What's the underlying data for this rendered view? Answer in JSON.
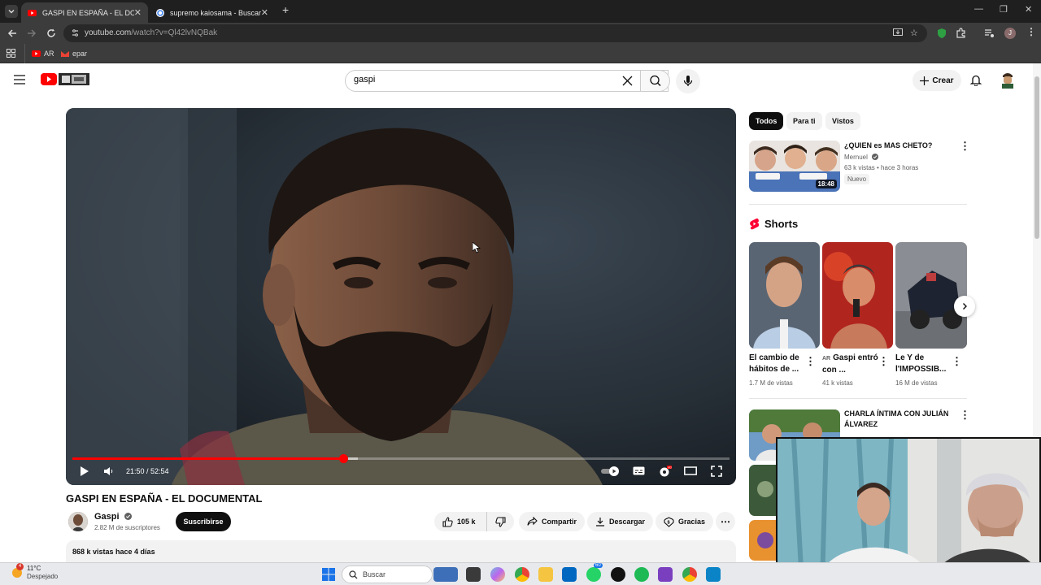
{
  "browser": {
    "tabs": [
      {
        "title": "GASPI EN ESPAÑA - EL DOCUM",
        "active": true
      },
      {
        "title": "supremo kaiosama - Buscar co",
        "active": false
      }
    ],
    "url": {
      "host": "youtube.com",
      "path": "/watch?v=Ql42lvNQBak"
    },
    "bookmarks": [
      "AR",
      "epar"
    ]
  },
  "youtube": {
    "search": {
      "query": "gaspi"
    },
    "create_label": "Crear"
  },
  "player": {
    "time": "21:50 / 52:54",
    "progress": 0.413,
    "buffered": 0.435
  },
  "video": {
    "title": "GASPI EN ESPAÑA - EL DOCUMENTAL",
    "channel": "Gaspi",
    "subscribers": "2.82 M de suscriptores",
    "subscribe_label": "Suscribirse",
    "likes": "105 k",
    "share_label": "Compartir",
    "download_label": "Descargar",
    "thanks_label": "Gracias",
    "meta": "868 k vistas  hace 4 días"
  },
  "sidebar": {
    "chips": [
      "Todos",
      "Para ti",
      "Vistos"
    ],
    "first_video": {
      "title": "¿QUIEN es MAS CHETO?",
      "channel": "Mernuel",
      "meta": "63 k vistas • hace 3 horas",
      "badge": "Nuevo",
      "duration": "18:48"
    },
    "shorts_heading": "Shorts",
    "shorts": [
      {
        "title": "El cambio de hábitos de ...",
        "views": "1.7 M de vistas"
      },
      {
        "title": "Gaspi entró con ...",
        "views": "41 k vistas",
        "prefix": "AR"
      },
      {
        "title": "Le Y de l'IMPOSSIB...",
        "views": "16 M de vistas"
      }
    ],
    "second_video": {
      "title": "CHARLA ÍNTIMA CON JULIÁN ÁLVAREZ"
    }
  },
  "taskbar": {
    "temperature": "11°C",
    "weather": "Despejado",
    "notification_count": "4",
    "search_label": "Buscar",
    "whatsapp_badge": "60"
  },
  "colors": {
    "youtube_red": "#ff0000",
    "chrome_dark": "#1f1f1f",
    "chrome_toolbar": "#3c3c3c"
  }
}
